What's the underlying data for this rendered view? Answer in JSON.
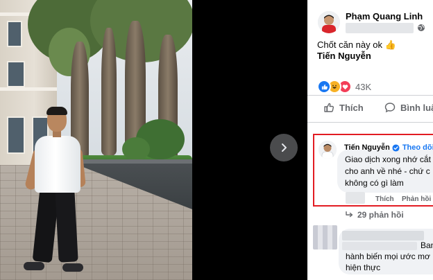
{
  "post": {
    "author": "Phạm Quang Linh",
    "text": "Chốt căn này ok",
    "text_emoji": "👍",
    "tagged": "Tiến Nguyễn",
    "reactions": {
      "types": [
        "like-icon",
        "haha-icon",
        "love-icon"
      ],
      "count": "43K"
    },
    "actions": {
      "like": "Thích",
      "comment": "Bình luận"
    }
  },
  "viewer": {
    "next_icon": "chevron-right-icon"
  },
  "comment": {
    "author": "Tiến Nguyễn",
    "follow": "Theo dõi",
    "lines": [
      "Giao dịch xong nhớ cắt",
      "cho anh về nhé - chứ c",
      "không có gì làm"
    ],
    "like": "Thích",
    "reply": "Phản hồi",
    "replies": "29 phản hồi"
  },
  "comment2": {
    "tail": "Ban",
    "lines": [
      "hành biến mọi ước mơ",
      "hiện thực"
    ]
  },
  "colors": {
    "highlight": "#e21b22",
    "link": "#1877f2",
    "muted": "#65676b"
  }
}
